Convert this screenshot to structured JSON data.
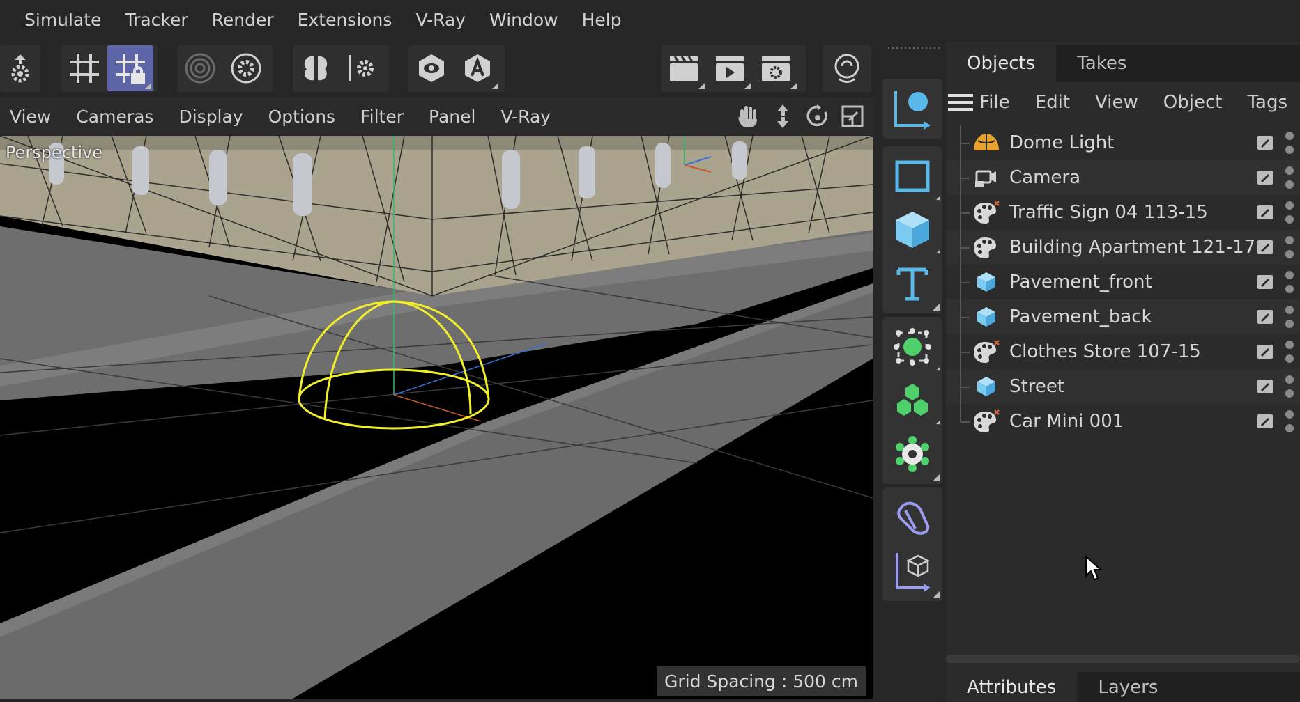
{
  "menubar": [
    "Simulate",
    "Tracker",
    "Render",
    "Extensions",
    "V-Ray",
    "Window",
    "Help"
  ],
  "toolbar": {
    "icons": [
      "hierarchy-gear-icon",
      "snap-grid-icon",
      "snap-grid-lock-icon",
      "target-rings-icon",
      "target-gear-icon",
      "symmetry-icon",
      "symmetry-gear-icon",
      "visibility-eye-icon",
      "text-a-icon",
      "render-clapper-icon",
      "render-play-icon",
      "render-settings-icon",
      "workplane-circle-icon"
    ]
  },
  "viewport_menu": [
    "View",
    "Cameras",
    "Display",
    "Options",
    "Filter",
    "Panel",
    "V-Ray"
  ],
  "viewport": {
    "label": "Perspective",
    "grid_status": "Grid Spacing : 500 cm"
  },
  "palette": {
    "icons": [
      "move-sphere-icon",
      "plane-square-icon",
      "cube-icon",
      "text-t-icon",
      "light-target-icon",
      "cloner-cubes-icon",
      "gear-generator-icon",
      "deformer-shape-icon",
      "axis-cube-icon"
    ]
  },
  "objects_panel": {
    "tabs": [
      "Objects",
      "Takes"
    ],
    "menu": [
      "File",
      "Edit",
      "View",
      "Object",
      "Tags"
    ],
    "items": [
      {
        "name": "Dome Light",
        "icon": "dome-light-icon"
      },
      {
        "name": "Camera",
        "icon": "camera-icon"
      },
      {
        "name": "Traffic Sign 04 113-15",
        "icon": "asset-palette-icon"
      },
      {
        "name": "Building Apartment 121-17",
        "icon": "asset-palette-icon"
      },
      {
        "name": "Pavement_front",
        "icon": "cube-object-icon"
      },
      {
        "name": "Pavement_back",
        "icon": "cube-object-icon"
      },
      {
        "name": "Clothes Store 107-15",
        "icon": "asset-palette-icon"
      },
      {
        "name": "Street",
        "icon": "cube-object-icon"
      },
      {
        "name": "Car Mini 001",
        "icon": "asset-palette-icon"
      }
    ],
    "bottom_tabs": [
      "Attributes",
      "Layers"
    ]
  },
  "colors": {
    "accent_blue": "#5ab8e8",
    "active_button": "#5e64a8",
    "dome_yellow": "#f0ef2a",
    "green_icons": "#4fd06a"
  }
}
